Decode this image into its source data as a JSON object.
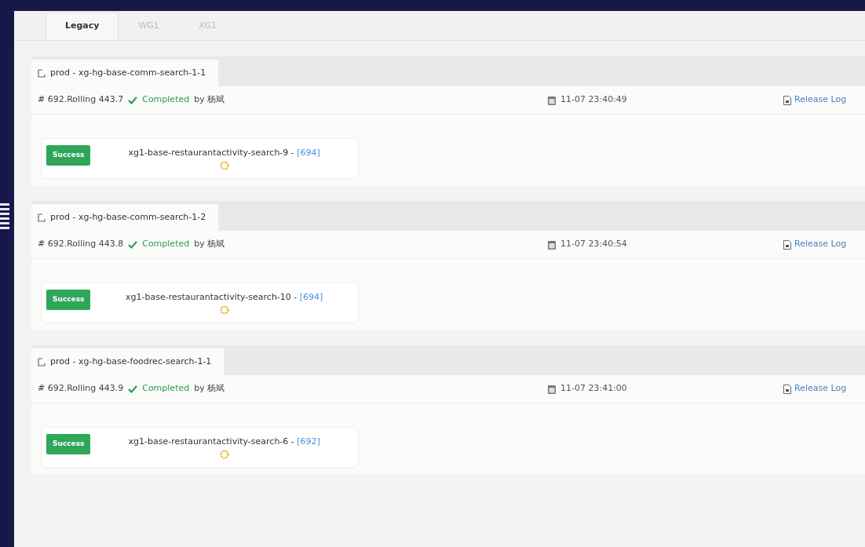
{
  "tabs": [
    {
      "label": "Legacy",
      "selected": true
    },
    {
      "label": "WG1",
      "selected": false
    },
    {
      "label": "XG1",
      "selected": false
    }
  ],
  "deployments": [
    {
      "title": "prod - xg-hg-base-comm-search-1-1",
      "build": "# 692.Rolling 443.7",
      "completed": true,
      "status": "Completed",
      "by": "by 杨斌",
      "time": "11-07 23:40:49",
      "log_link": "Release Log",
      "tasks": [
        {
          "badge": "Success",
          "kind": "success",
          "name": "xg1-base-restaurantactivity-search-9 - ",
          "link": "[694]"
        }
      ]
    },
    {
      "title": "prod - xg-hg-base-comm-search-1-2",
      "build": "# 692.Rolling 443.8",
      "completed": true,
      "status": "Completed",
      "by": "by 杨斌",
      "time": "11-07 23:40:54",
      "log_link": "Release Log",
      "tasks": [
        {
          "badge": "Success",
          "kind": "success",
          "name": "xg1-base-restaurantactivity-search-10 - ",
          "link": "[694]"
        }
      ]
    },
    {
      "title": "prod - xg-hg-base-foodrec-search-1-1",
      "build": "# 692.Rolling 443.9",
      "completed": true,
      "status": "Completed",
      "by": "by 杨斌",
      "time": "11-07 23:41:00",
      "log_link": "Release Log",
      "tasks": [
        {
          "badge": "Success",
          "kind": "success",
          "name": "xg1-base-restaurantactivity-search-6 - ",
          "link": "[692]"
        }
      ]
    }
  ]
}
